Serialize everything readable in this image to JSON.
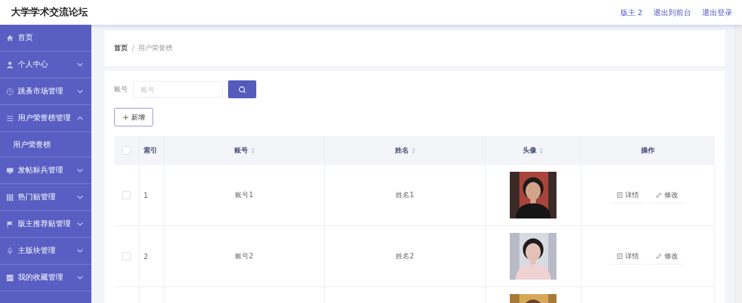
{
  "header": {
    "title": "大学学术交流论坛",
    "links": [
      "版主 2",
      "退出到前台",
      "退出登录"
    ]
  },
  "sidebar": {
    "items": [
      {
        "label": "首页"
      },
      {
        "label": "个人中心",
        "expanded": false
      },
      {
        "label": "跳蚤市场管理",
        "expanded": false
      },
      {
        "label": "用户荣誉榜管理",
        "expanded": true,
        "children": [
          {
            "label": "用户荣誉榜"
          }
        ]
      },
      {
        "label": "发帖标兵管理",
        "expanded": false
      },
      {
        "label": "热门贴管理",
        "expanded": false
      },
      {
        "label": "版主推荐贴管理",
        "expanded": false
      },
      {
        "label": "主版块管理",
        "expanded": false
      },
      {
        "label": "我的收藏管理",
        "expanded": false
      }
    ]
  },
  "breadcrumb": {
    "items": [
      "首页",
      "用户荣誉榜"
    ],
    "separator": "/"
  },
  "search": {
    "label": "账号",
    "placeholder": "账号"
  },
  "add_button": "新增",
  "table": {
    "all_checked": false,
    "columns": [
      {
        "label": "索引",
        "sortable": false
      },
      {
        "label": "账号",
        "sortable": true
      },
      {
        "label": "姓名",
        "sortable": true
      },
      {
        "label": "头像",
        "sortable": true
      },
      {
        "label": "操作",
        "sortable": false
      }
    ],
    "rows": [
      {
        "index": "1",
        "account": "账号1",
        "name": "姓名1",
        "avatar": {
          "kind": "picture"
        },
        "actions": [
          "详情",
          "修改"
        ],
        "checked": false
      },
      {
        "index": "2",
        "account": "账号2",
        "name": "姓名2",
        "avatar": {
          "kind": "picture"
        },
        "actions": [
          "详情",
          "修改"
        ],
        "checked": false
      },
      {
        "avatar": {
          "kind": "picture"
        }
      }
    ]
  }
}
